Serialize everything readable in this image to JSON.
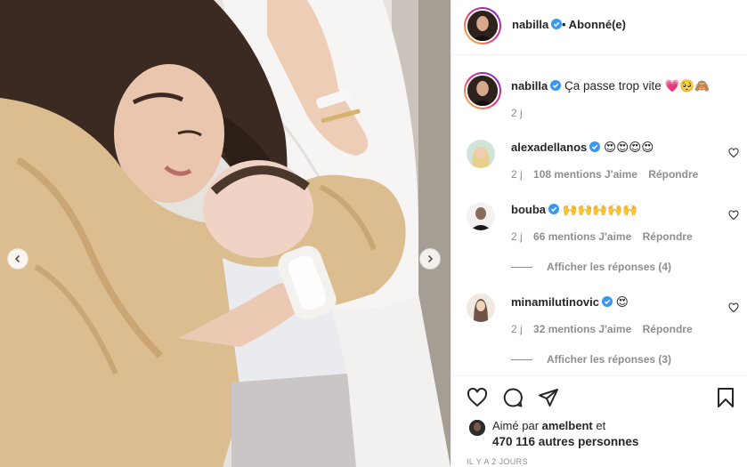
{
  "post_header": {
    "username": "nabilla",
    "verified": true,
    "follow_status": "• Abonné(e)"
  },
  "caption": {
    "username": "nabilla",
    "text": "Ça passe trop vite",
    "emojis": "💗🥺🙈",
    "time": "2 j"
  },
  "comments": [
    {
      "username": "alexadellanos",
      "text": "😍😍😍😍",
      "time": "2 j",
      "likes": "108 mentions J'aime",
      "reply_label": "Répondre"
    },
    {
      "username": "bouba",
      "text": "🙌🙌🙌🙌🙌",
      "time": "2 j",
      "likes": "66 mentions J'aime",
      "reply_label": "Répondre",
      "view_replies": "Afficher les réponses (4)"
    },
    {
      "username": "minamilutinovic",
      "text": "😍",
      "time": "2 j",
      "likes": "32 mentions J'aime",
      "reply_label": "Répondre",
      "view_replies": "Afficher les réponses (3)"
    }
  ],
  "likes": {
    "prefix": "Aimé par",
    "user": "amelbent",
    "connector": "et",
    "others": "470 116 autres personnes"
  },
  "timestamp": "IL Y A 2 JOURS",
  "icons": {
    "like": "heart-icon",
    "comment": "comment-icon",
    "share": "paper-plane-icon",
    "save": "bookmark-icon",
    "verified": "verified-badge-icon"
  },
  "colors": {
    "verified_blue": "#3897f0",
    "meta_gray": "#8e8e8e",
    "text": "#262626"
  }
}
